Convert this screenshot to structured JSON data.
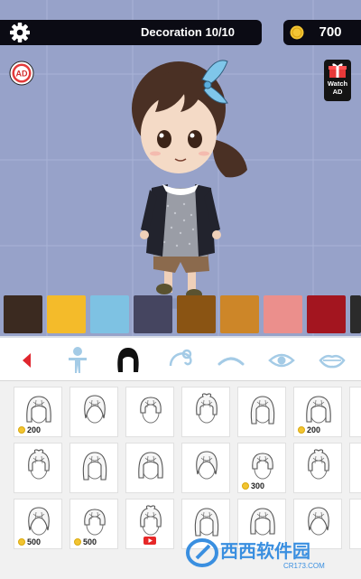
{
  "header": {
    "decoration_label": "Decoration 10/10",
    "coins": "700",
    "settings_icon": "gear-icon",
    "coin_icon": "coin-icon"
  },
  "stage": {
    "background": "#97a2c9",
    "ad_badge": "AD",
    "watch_ad": {
      "line1": "Watch",
      "line2": "AD"
    }
  },
  "palette": {
    "colors": [
      "#3b2a20",
      "#f4bb2a",
      "#7ec2e3",
      "#454560",
      "#8a5413",
      "#cd8628",
      "#eb8f8c",
      "#a3151f",
      "#2b2b2b"
    ]
  },
  "tabs": [
    {
      "name": "back",
      "icon": "back-arrow-icon"
    },
    {
      "name": "body",
      "icon": "body-icon"
    },
    {
      "name": "hair",
      "icon": "hair-icon",
      "active": true
    },
    {
      "name": "ear",
      "icon": "ear-icon"
    },
    {
      "name": "eyebrow",
      "icon": "eyebrow-icon"
    },
    {
      "name": "eye",
      "icon": "eye-icon"
    },
    {
      "name": "mouth",
      "icon": "mouth-icon"
    }
  ],
  "items": {
    "rows": [
      [
        {
          "price": "200"
        },
        {
          "price": ""
        },
        {
          "price": ""
        },
        {
          "price": ""
        },
        {
          "price": ""
        },
        {
          "price": "200"
        },
        {
          "price": ""
        }
      ],
      [
        {
          "price": ""
        },
        {
          "price": ""
        },
        {
          "price": ""
        },
        {
          "price": ""
        },
        {
          "price": "300"
        },
        {
          "price": ""
        },
        {
          "price": ""
        }
      ],
      [
        {
          "price": "500"
        },
        {
          "price": "500"
        },
        {
          "price": "",
          "video": true
        },
        {
          "price": ""
        },
        {
          "price": ""
        },
        {
          "price": ""
        },
        {
          "price": ""
        }
      ]
    ]
  }
}
